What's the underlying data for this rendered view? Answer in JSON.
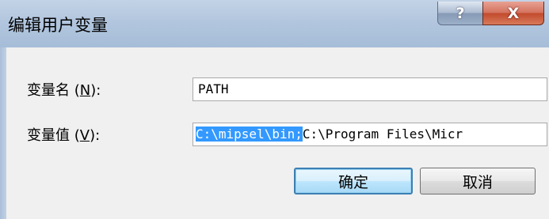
{
  "window": {
    "title": "编辑用户变量",
    "help_glyph": "?",
    "close_glyph": "X"
  },
  "form": {
    "name_label_prefix": "变量名 (",
    "name_label_key": "N",
    "name_label_suffix": "):",
    "name_value": "PATH",
    "value_label_prefix": "变量值 (",
    "value_label_key": "V",
    "value_label_suffix": "):",
    "value_selected": "C:\\mipsel\\bin;",
    "value_rest": "C:\\Program Files\\Micr"
  },
  "buttons": {
    "ok": "确定",
    "cancel": "取消"
  },
  "colors": {
    "selection": "#3399ff",
    "titlebar": "#b2c6de",
    "close_button": "#c24b2e"
  }
}
